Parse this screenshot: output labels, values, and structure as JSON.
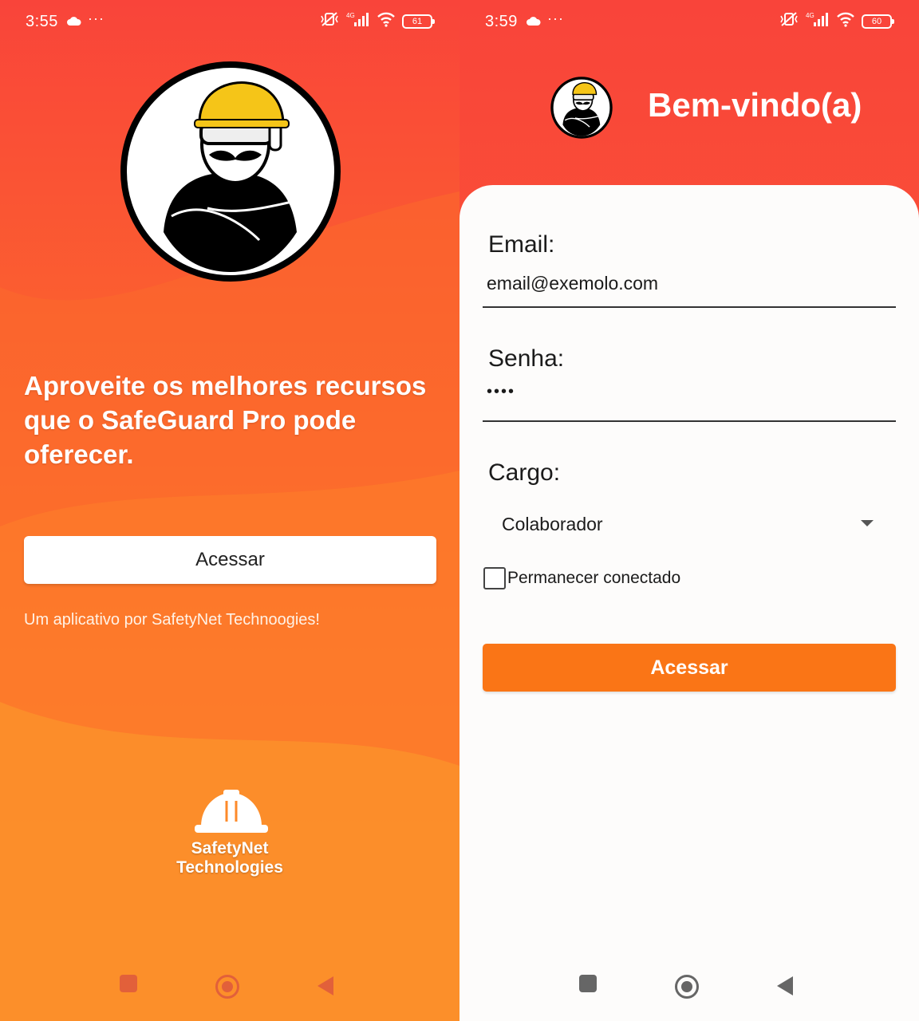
{
  "left_screen": {
    "status_bar": {
      "time": "3:55",
      "overflow": "···",
      "network": "4G",
      "battery": "61"
    },
    "logo_icon": "worker-mascot-icon",
    "tagline": "Aproveite os melhores recursos que o SafeGuard Pro pode oferecer.",
    "access_button": "Acessar",
    "byline": "Um aplicativo por SafetyNet Technoogies!",
    "company_logo_icon": "hard-hat-icon",
    "company_name": "SafetyNet Technologies"
  },
  "right_screen": {
    "status_bar": {
      "time": "3:59",
      "overflow": "···",
      "network": "4G",
      "battery": "60"
    },
    "logo_icon": "worker-mascot-icon",
    "welcome": "Bem-vindo(a)",
    "form": {
      "email_label": "Email:",
      "email_value": "email@exemolo.com",
      "password_label": "Senha:",
      "password_value": "••••",
      "role_label": "Cargo:",
      "role_value": "Colaborador",
      "remember_label": "Permanecer conectado",
      "remember_checked": false,
      "submit_label": "Acessar"
    }
  },
  "nav_icons": [
    "recent-apps-icon",
    "home-icon",
    "back-icon"
  ],
  "colors": {
    "gradient_top": "#f9443a",
    "gradient_bottom": "#fca02a",
    "primary_button": "#fa7516",
    "helmet_yellow": "#f5c518"
  }
}
